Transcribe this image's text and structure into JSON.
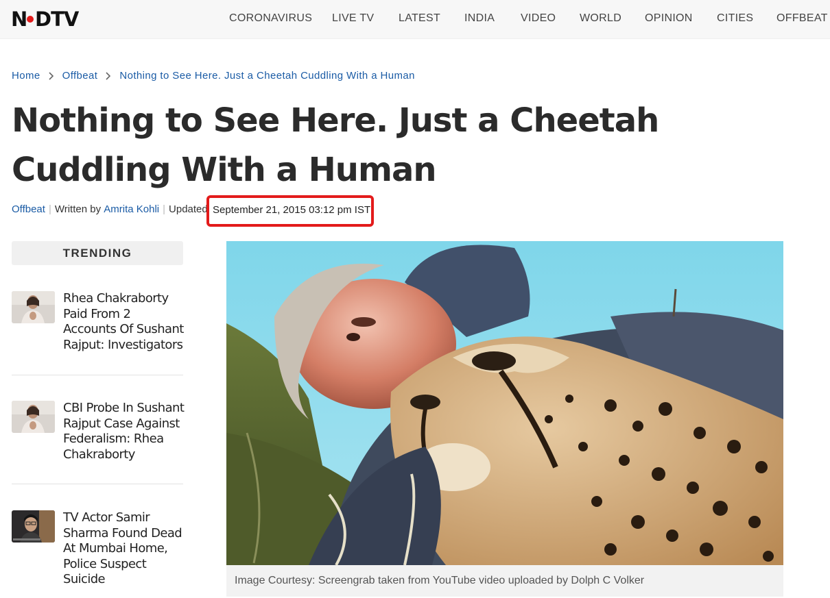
{
  "site": {
    "logo_text": "NDTV",
    "accent": "#e31b1b",
    "link_color": "#1a5ba5"
  },
  "nav": {
    "items": [
      "CORONAVIRUS",
      "LIVE TV",
      "LATEST",
      "INDIA",
      "VIDEO",
      "WORLD",
      "OPINION",
      "CITIES",
      "OFFBEAT"
    ]
  },
  "breadcrumb": {
    "home": "Home",
    "section": "Offbeat",
    "current": "Nothing to See Here. Just a Cheetah Cuddling With a Human"
  },
  "article": {
    "title": "Nothing to See Here. Just a Cheetah Cuddling With a Human",
    "category": "Offbeat",
    "written_by": "Written by",
    "author": "Amrita Kohli",
    "updated_label": "Updated:",
    "date": "September 21, 2015 03:12 pm IST",
    "caption": "Image Courtesy: Screengrab taken from YouTube video uploaded by Dolph C Volker"
  },
  "sidebar": {
    "heading": "TRENDING",
    "items": [
      {
        "title": "Rhea Chakraborty Paid From 2 Accounts Of Sushant Rajput: Investigators"
      },
      {
        "title": "CBI Probe In Sushant Rajput Case Against Federalism: Rhea Chakraborty"
      },
      {
        "title": "TV Actor Samir Sharma Found Dead At Mumbai Home, Police Suspect Suicide"
      }
    ]
  }
}
